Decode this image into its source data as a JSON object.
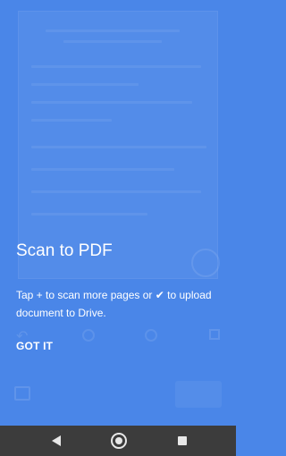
{
  "tutorial": {
    "title": "Scan to PDF",
    "description_prefix": "Tap + to scan more pages or ",
    "check_glyph": "✔",
    "description_suffix": " to upload document to Drive.",
    "dismiss_label": "GOT IT"
  },
  "colors": {
    "overlay": "#4a86e8",
    "navbar": "#3c3c3c"
  },
  "icons": {
    "check": "check-icon",
    "nav_back": "back-icon",
    "nav_home": "home-icon",
    "nav_recent": "recent-apps-icon"
  }
}
